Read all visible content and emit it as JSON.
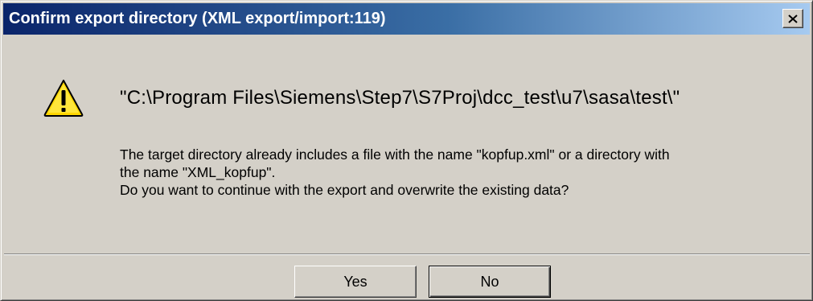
{
  "window": {
    "title": "Confirm export directory (XML export/import:119)",
    "close_icon": "close-icon"
  },
  "icon": {
    "name": "warning-icon",
    "color": "#ffd700"
  },
  "message": {
    "path": "\"C:\\Program Files\\Siemens\\Step7\\S7Proj\\dcc_test\\u7\\sasa\\test\\\"",
    "line1": "The target directory already includes a file with the name \"kopfup.xml\" or a directory with",
    "line2": "the name \"XML_kopfup\".",
    "line3": "Do you want to continue with the export and overwrite the existing data?"
  },
  "buttons": {
    "yes_label": "Yes",
    "no_label": "No"
  },
  "colors": {
    "dialog_bg": "#d4d0c8",
    "titlebar_start": "#0a246a",
    "titlebar_end": "#a6caf0"
  }
}
